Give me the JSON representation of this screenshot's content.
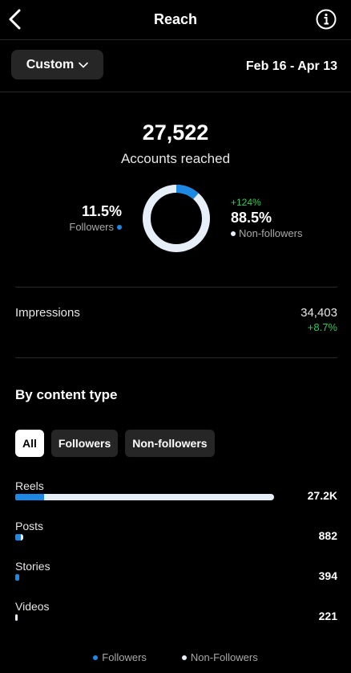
{
  "header": {
    "title": "Reach",
    "back_icon": "chevron-left-icon",
    "info_icon": "info-circle-icon"
  },
  "toolbar": {
    "range_label": "Custom",
    "date_range": "Feb 16 - Apr 13"
  },
  "summary": {
    "total": "27,522",
    "total_label": "Accounts reached",
    "followers_pct": "11.5%",
    "followers_label": "Followers",
    "nonfollowers_change": "+124%",
    "nonfollowers_pct": "88.5%",
    "nonfollowers_label": "Non-followers",
    "followers_fraction": 0.115
  },
  "impressions": {
    "label": "Impressions",
    "value": "34,403",
    "change": "+8.7%"
  },
  "content_type": {
    "title": "By content type",
    "filters": [
      "All",
      "Followers",
      "Non-followers"
    ],
    "active_filter": "All",
    "rows": [
      {
        "label": "Reels",
        "value": "27.2K",
        "total": 27200,
        "followers_fraction": 0.11
      },
      {
        "label": "Posts",
        "value": "882",
        "total": 882,
        "followers_fraction": 0.7
      },
      {
        "label": "Stories",
        "value": "394",
        "total": 394,
        "followers_fraction": 1.0
      },
      {
        "label": "Videos",
        "value": "221",
        "total": 221,
        "followers_fraction": 0.0
      }
    ]
  },
  "legend": {
    "followers": "Followers",
    "nonfollowers": "Non-Followers"
  },
  "colors": {
    "followers": "#1e88e5",
    "nonfollowers": "#e6eef7",
    "positive": "#34c759"
  }
}
